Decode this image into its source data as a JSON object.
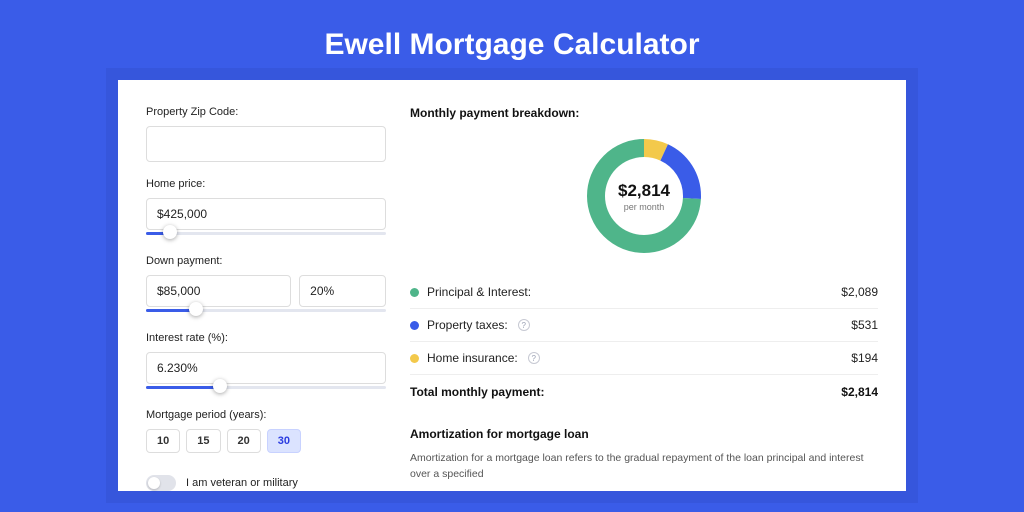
{
  "title": "Ewell Mortgage Calculator",
  "form": {
    "zip_label": "Property Zip Code:",
    "zip_value": "",
    "home_price_label": "Home price:",
    "home_price_value": "$425,000",
    "home_price_slider_pct": 10,
    "down_payment_label": "Down payment:",
    "down_payment_value": "$85,000",
    "down_payment_pct_value": "20%",
    "down_payment_slider_pct": 21,
    "interest_label": "Interest rate (%):",
    "interest_value": "6.230%",
    "interest_slider_pct": 31,
    "period_label": "Mortgage period (years):",
    "periods": [
      "10",
      "15",
      "20",
      "30"
    ],
    "period_active_index": 3,
    "veteran_label": "I am veteran or military",
    "veteran_on": false
  },
  "breakdown": {
    "title": "Monthly payment breakdown:",
    "center_amount": "$2,814",
    "center_sub": "per month",
    "items": [
      {
        "label": "Principal & Interest:",
        "value": "$2,089",
        "color": "#4fb58a",
        "pct": 74.2,
        "has_info": false
      },
      {
        "label": "Property taxes:",
        "value": "$531",
        "color": "#3a5ce8",
        "pct": 18.9,
        "has_info": true
      },
      {
        "label": "Home insurance:",
        "value": "$194",
        "color": "#f3c94b",
        "pct": 6.9,
        "has_info": true
      }
    ],
    "total_label": "Total monthly payment:",
    "total_value": "$2,814"
  },
  "amortization": {
    "title": "Amortization for mortgage loan",
    "text": "Amortization for a mortgage loan refers to the gradual repayment of the loan principal and interest over a specified"
  },
  "chart_data": {
    "type": "pie",
    "title": "Monthly payment breakdown",
    "series": [
      {
        "name": "Principal & Interest",
        "value": 2089,
        "color": "#4fb58a"
      },
      {
        "name": "Property taxes",
        "value": 531,
        "color": "#3a5ce8"
      },
      {
        "name": "Home insurance",
        "value": 194,
        "color": "#f3c94b"
      }
    ],
    "total": 2814,
    "center_label": "$2,814 per month"
  }
}
